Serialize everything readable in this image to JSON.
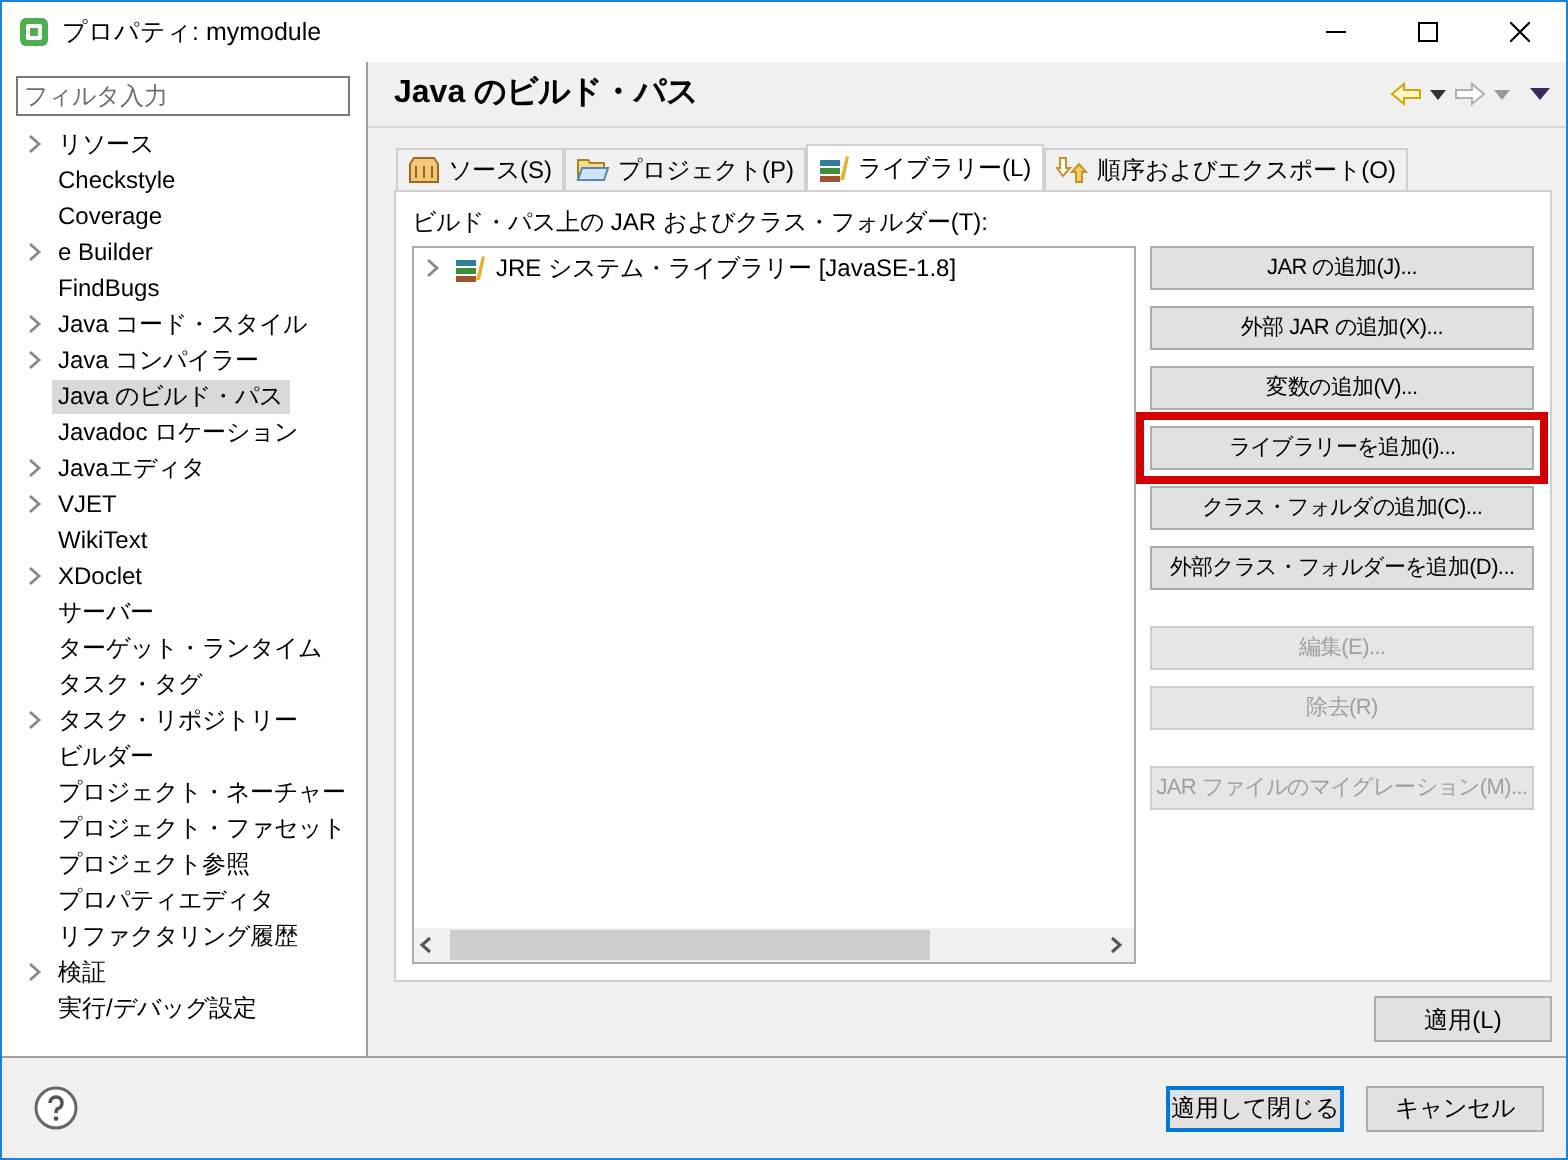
{
  "window": {
    "title": "プロパティ: mymodule"
  },
  "filter": {
    "placeholder": "フィルタ入力"
  },
  "sidebar": {
    "items": [
      {
        "label": "リソース",
        "expandable": true,
        "selected": false
      },
      {
        "label": "Checkstyle",
        "expandable": false,
        "selected": false
      },
      {
        "label": "Coverage",
        "expandable": false,
        "selected": false
      },
      {
        "label": "e Builder",
        "expandable": true,
        "selected": false
      },
      {
        "label": "FindBugs",
        "expandable": false,
        "selected": false
      },
      {
        "label": "Java コード・スタイル",
        "expandable": true,
        "selected": false
      },
      {
        "label": "Java コンパイラー",
        "expandable": true,
        "selected": false
      },
      {
        "label": "Java のビルド・パス",
        "expandable": false,
        "selected": true
      },
      {
        "label": "Javadoc ロケーション",
        "expandable": false,
        "selected": false
      },
      {
        "label": "Javaエディタ",
        "expandable": true,
        "selected": false
      },
      {
        "label": "VJET",
        "expandable": true,
        "selected": false
      },
      {
        "label": "WikiText",
        "expandable": false,
        "selected": false
      },
      {
        "label": "XDoclet",
        "expandable": true,
        "selected": false
      },
      {
        "label": "サーバー",
        "expandable": false,
        "selected": false
      },
      {
        "label": "ターゲット・ランタイム",
        "expandable": false,
        "selected": false
      },
      {
        "label": "タスク・タグ",
        "expandable": false,
        "selected": false
      },
      {
        "label": "タスク・リポジトリー",
        "expandable": true,
        "selected": false
      },
      {
        "label": "ビルダー",
        "expandable": false,
        "selected": false
      },
      {
        "label": "プロジェクト・ネーチャー",
        "expandable": false,
        "selected": false
      },
      {
        "label": "プロジェクト・ファセット",
        "expandable": false,
        "selected": false
      },
      {
        "label": "プロジェクト参照",
        "expandable": false,
        "selected": false
      },
      {
        "label": "プロパティエディタ",
        "expandable": false,
        "selected": false
      },
      {
        "label": "リファクタリング履歴",
        "expandable": false,
        "selected": false
      },
      {
        "label": "検証",
        "expandable": true,
        "selected": false
      },
      {
        "label": "実行/デバッグ設定",
        "expandable": false,
        "selected": false
      }
    ]
  },
  "page": {
    "title": "Java のビルド・パス",
    "tabs": [
      {
        "label": "ソース(S)",
        "kind": "source",
        "selected": false
      },
      {
        "label": "プロジェクト(P)",
        "kind": "project",
        "selected": false
      },
      {
        "label": "ライブラリー(L)",
        "kind": "library",
        "selected": true
      },
      {
        "label": "順序およびエクスポート(O)",
        "kind": "order",
        "selected": false
      }
    ],
    "list_label": "ビルド・パス上の JAR およびクラス・フォルダー(T):",
    "entries": [
      {
        "label": "JRE システム・ライブラリー [JavaSE-1.8]",
        "expanded": false
      }
    ],
    "button_groups": [
      [
        {
          "label": "JAR の追加(J)...",
          "disabled": false,
          "highlighted": false
        },
        {
          "label": "外部 JAR の追加(X)...",
          "disabled": false,
          "highlighted": false
        },
        {
          "label": "変数の追加(V)...",
          "disabled": false,
          "highlighted": false
        },
        {
          "label": "ライブラリーを追加(i)...",
          "disabled": false,
          "highlighted": true
        },
        {
          "label": "クラス・フォルダの追加(C)...",
          "disabled": false,
          "highlighted": false
        },
        {
          "label": "外部クラス・フォルダーを追加(D)...",
          "disabled": false,
          "highlighted": false
        }
      ],
      [
        {
          "label": "編集(E)...",
          "disabled": true,
          "highlighted": false
        },
        {
          "label": "除去(R)",
          "disabled": true,
          "highlighted": false
        }
      ],
      [
        {
          "label": "JAR ファイルのマイグレーション(M)...",
          "disabled": true,
          "highlighted": false
        }
      ]
    ],
    "apply_button": "適用(L)"
  },
  "footer": {
    "buttons": [
      {
        "label": "適用して閉じる",
        "default": true
      },
      {
        "label": "キャンセル",
        "default": false
      }
    ]
  }
}
